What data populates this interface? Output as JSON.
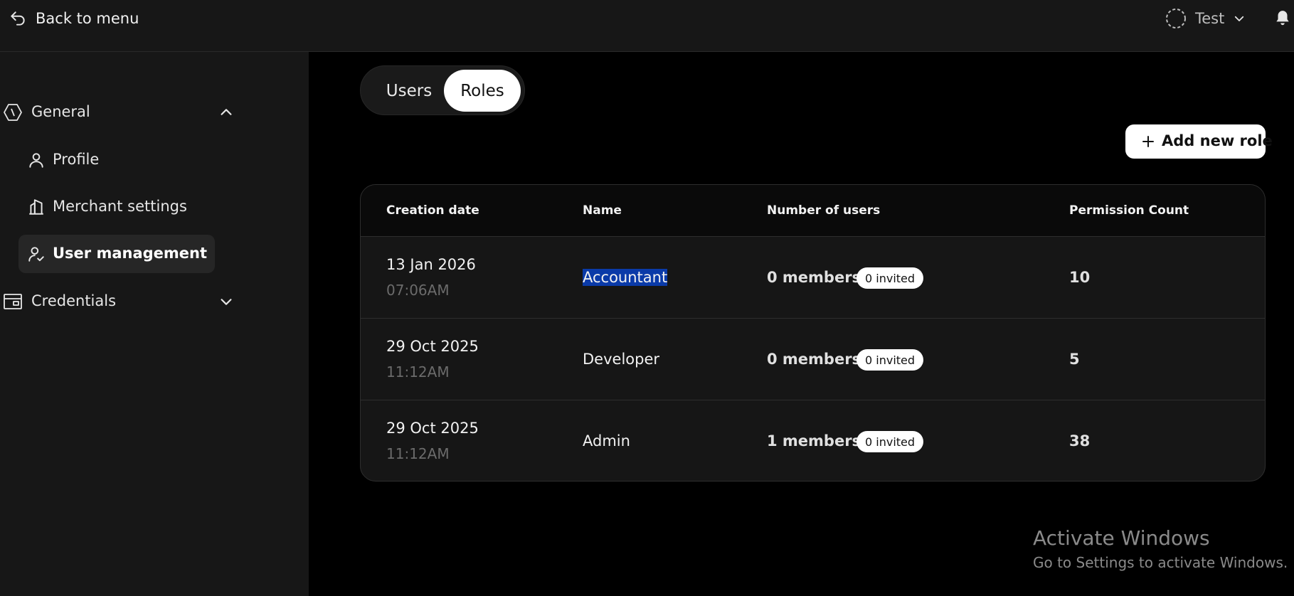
{
  "topbar": {
    "back_label": "Back to menu",
    "merchant_label": "Test"
  },
  "sidebar": {
    "sections": [
      {
        "label": "General",
        "expanded": true
      },
      {
        "label": "Credentials",
        "expanded": false
      }
    ],
    "items": [
      {
        "label": "Profile",
        "active": false
      },
      {
        "label": "Merchant settings",
        "active": false
      },
      {
        "label": "User management",
        "active": true
      }
    ]
  },
  "tabs": [
    {
      "label": "Users",
      "active": false
    },
    {
      "label": "Roles",
      "active": true
    }
  ],
  "actions": {
    "add_role_label": "Add new role"
  },
  "table": {
    "columns": [
      "Creation date",
      "Name",
      "Number of users",
      "Permission Count"
    ],
    "rows": [
      {
        "date": "13 Jan 2026",
        "time": "07:06AM",
        "name": "Accountant",
        "members": "0 members",
        "invited": "0 invited",
        "permissions": "10",
        "name_selected": true
      },
      {
        "date": "29 Oct 2025",
        "time": "11:12AM",
        "name": "Developer",
        "members": "0 members",
        "invited": "0 invited",
        "permissions": "5",
        "name_selected": false
      },
      {
        "date": "29 Oct 2025",
        "time": "11:12AM",
        "name": "Admin",
        "members": "1 members",
        "invited": "0 invited",
        "permissions": "38",
        "name_selected": false
      }
    ]
  },
  "watermark": {
    "title": "Activate Windows",
    "subtitle": "Go to Settings to activate Windows."
  },
  "colors": {
    "background": "#000000",
    "surface": "#171717",
    "selection": "#0a3aa8",
    "pill": "#ffffff"
  }
}
